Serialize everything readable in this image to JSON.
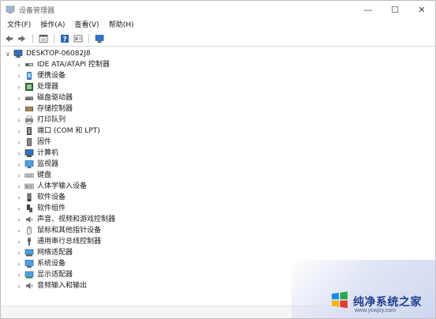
{
  "window": {
    "title": "设备管理器",
    "min_glyph": "—",
    "max_glyph": "☐",
    "close_glyph": "✕"
  },
  "menu": [
    {
      "label": "文件(F)"
    },
    {
      "label": "操作(A)"
    },
    {
      "label": "查看(V)"
    },
    {
      "label": "帮助(H)"
    }
  ],
  "toolbar": [
    "back-arrow-icon",
    "forward-arrow-icon",
    "properties-icon",
    "help-icon",
    "show-hidden-icon",
    "scan-monitor-icon"
  ],
  "tree": {
    "root": {
      "label": "DESKTOP-06082J8",
      "icon": "computer-icon",
      "expanded": true
    },
    "items": [
      {
        "label": "IDE ATA/ATAPI 控制器",
        "icon": "ide-controller-icon"
      },
      {
        "label": "便携设备",
        "icon": "portable-device-icon"
      },
      {
        "label": "处理器",
        "icon": "processor-icon"
      },
      {
        "label": "磁盘驱动器",
        "icon": "disk-drive-icon"
      },
      {
        "label": "存储控制器",
        "icon": "storage-controller-icon"
      },
      {
        "label": "打印队列",
        "icon": "printer-icon"
      },
      {
        "label": "端口 (COM 和 LPT)",
        "icon": "port-icon"
      },
      {
        "label": "固件",
        "icon": "firmware-icon"
      },
      {
        "label": "计算机",
        "icon": "computer-icon"
      },
      {
        "label": "监视器",
        "icon": "monitor-icon"
      },
      {
        "label": "键盘",
        "icon": "keyboard-icon"
      },
      {
        "label": "人体学输入设备",
        "icon": "hid-icon"
      },
      {
        "label": "软件设备",
        "icon": "software-device-icon"
      },
      {
        "label": "软件组件",
        "icon": "software-component-icon"
      },
      {
        "label": "声音、视频和游戏控制器",
        "icon": "speaker-icon"
      },
      {
        "label": "鼠标和其他指针设备",
        "icon": "mouse-icon"
      },
      {
        "label": "通用串行总线控制器",
        "icon": "usb-icon"
      },
      {
        "label": "网络适配器",
        "icon": "network-adapter-icon"
      },
      {
        "label": "系统设备",
        "icon": "system-device-icon"
      },
      {
        "label": "显示适配器",
        "icon": "display-adapter-icon"
      },
      {
        "label": "音频输入和输出",
        "icon": "audio-io-icon"
      }
    ]
  },
  "watermark": {
    "brand": "纯净系统之家",
    "url": "www.ycwjzy.com"
  },
  "colors": {
    "accent": "#2b74c9",
    "watermark_text": "#1f3f8f"
  }
}
